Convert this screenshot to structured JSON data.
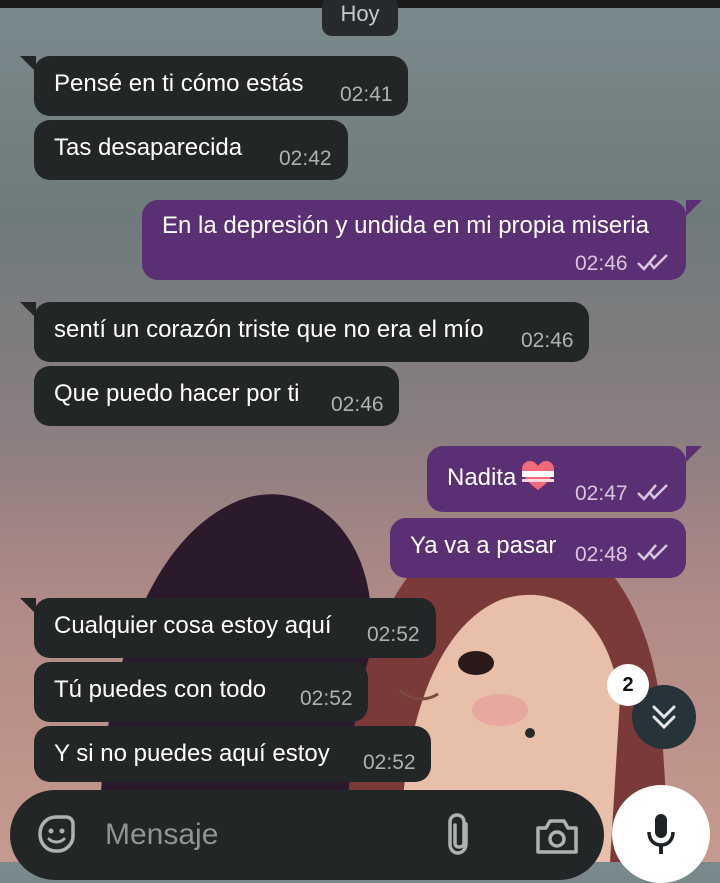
{
  "date_separator": "Hoy",
  "messages": [
    {
      "dir": "in",
      "text": "Pensé en ti cómo estás",
      "time": "02:41"
    },
    {
      "dir": "in",
      "text": "Tas desaparecida",
      "time": "02:42"
    },
    {
      "dir": "out",
      "text": "En la depresión y undida en mi propia miseria",
      "time": "02:46",
      "status": "read"
    },
    {
      "dir": "in",
      "text": "sentí un corazón triste que no era el mío",
      "time": "02:46"
    },
    {
      "dir": "in",
      "text": "Que puedo hacer por ti",
      "time": "02:46"
    },
    {
      "dir": "out",
      "text": "Nadita",
      "emoji": "heart-with-ribbon",
      "time": "02:47",
      "status": "read"
    },
    {
      "dir": "out",
      "text": "Ya va a pasar",
      "time": "02:48",
      "status": "read"
    },
    {
      "dir": "in",
      "text": "Cualquier cosa estoy aquí",
      "time": "02:52"
    },
    {
      "dir": "in",
      "text": "Tú puedes con todo",
      "time": "02:52"
    },
    {
      "dir": "in",
      "text": "Y si no puedes aquí estoy",
      "time": "02:52"
    }
  ],
  "scroll": {
    "unread_count": "2",
    "icon": "double-chevron-down-icon"
  },
  "composer": {
    "placeholder": "Mensaje",
    "icons": [
      "sticker-icon",
      "paperclip-icon",
      "camera-icon",
      "microphone-icon"
    ]
  },
  "colors": {
    "incoming": "#232627",
    "outgoing": "#5b2f74",
    "accent": "#ffffff"
  }
}
